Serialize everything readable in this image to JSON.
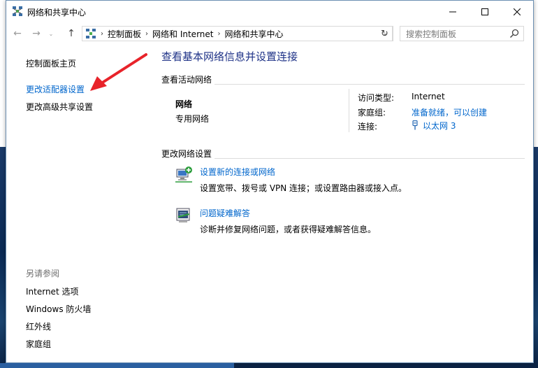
{
  "window": {
    "title": "网络和共享中心",
    "controls": {
      "minimize": "—",
      "maximize": "☐",
      "close": "✕"
    }
  },
  "navbar": {
    "back": "←",
    "forward": "→",
    "recent": "⌄",
    "up": "↑",
    "breadcrumbs": [
      "控制面板",
      "网络和 Internet",
      "网络和共享中心"
    ],
    "dropdown": "⌄",
    "refresh": "↻",
    "search_placeholder": "搜索控制面板"
  },
  "left_pane": {
    "home": "控制面板主页",
    "change_adapter": "更改适配器设置",
    "advanced_sharing": "更改高级共享设置",
    "see_also_title": "另请参阅",
    "see_also": [
      "Internet 选项",
      "Windows 防火墙",
      "红外线",
      "家庭组"
    ]
  },
  "main": {
    "title": "查看基本网络信息并设置连接",
    "active_networks_heading": "查看活动网络",
    "network_name": "网络",
    "network_profile": "专用网络",
    "details": {
      "access_type_label": "访问类型:",
      "access_type_value": "Internet",
      "homegroup_label": "家庭组:",
      "homegroup_value": "准备就绪，可以创建",
      "connections_label": "连接:",
      "connections_value": "以太网 3"
    },
    "change_settings_heading": "更改网络设置",
    "tasks": [
      {
        "link": "设置新的连接或网络",
        "desc": "设置宽带、拨号或 VPN 连接；或设置路由器或接入点。"
      },
      {
        "link": "问题疑难解答",
        "desc": "诊断并修复网络问题，或者获得疑难解答信息。"
      }
    ]
  },
  "colors": {
    "link": "#0066cc",
    "title_blue": "#1e3287",
    "annotation_red": "#e8232a"
  },
  "icons": {
    "title": "network-center-icon",
    "address": "control-panel-icon",
    "search": "search-icon",
    "ethernet": "ethernet-icon",
    "new_connection": "new-connection-icon",
    "troubleshoot": "troubleshoot-icon"
  }
}
